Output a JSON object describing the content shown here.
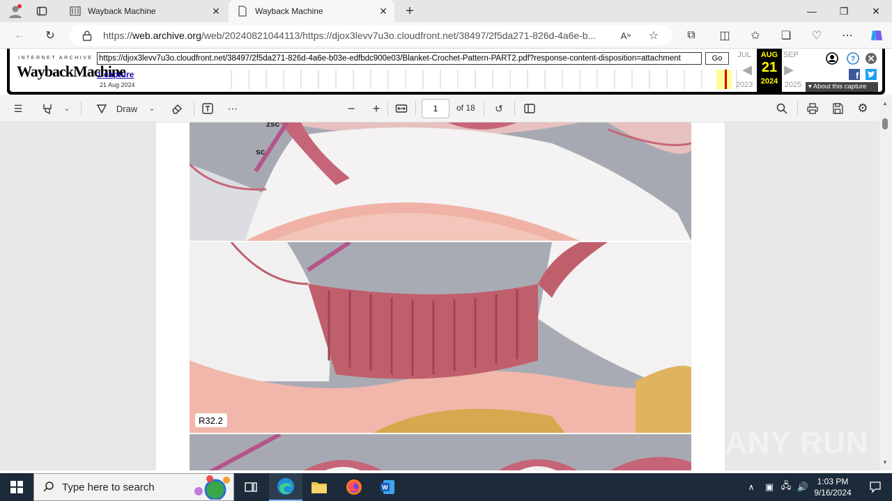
{
  "browser": {
    "tabs": [
      {
        "title": "Wayback Machine",
        "active": false
      },
      {
        "title": "Wayback Machine",
        "active": true
      }
    ],
    "new_tab_label": "+",
    "address": {
      "prefix": "https://",
      "domain": "web.archive.org",
      "rest": "/web/20240821044113/https://djox3levv7u3o.cloudfront.net/38497/2f5da271-826d-4a6e-b..."
    }
  },
  "wayback": {
    "logo_top": "INTERNET ARCHIVE",
    "logo_main": "WaybackMachine",
    "url_value": "https://djox3levv7u3o.cloudfront.net/38497/2f5da271-826d-4a6e-b03e-edfbdc900e03/Blanket-Crochet-Pattern-PART2.pdf?response-content-disposition=attachment",
    "go_label": "Go",
    "capture_link": "1 capture",
    "capture_date": "21 Aug 2024",
    "months": {
      "prev": "JUL",
      "current": "AUG",
      "next": "SEP"
    },
    "day": "21",
    "years": {
      "prev": "2023",
      "current": "2024",
      "next": "2025"
    },
    "about_label": "▾ About this capture"
  },
  "pdf_toolbar": {
    "draw_label": "Draw",
    "page_current": "1",
    "page_total": "of 18"
  },
  "pdf_content": {
    "label_zsc": "zsc",
    "label_sc": "sc",
    "photo_caption": "R32.2"
  },
  "taskbar": {
    "search_placeholder": "Type here to search",
    "time": "1:03 PM",
    "date": "9/16/2024"
  },
  "watermark": "ANY RUN"
}
